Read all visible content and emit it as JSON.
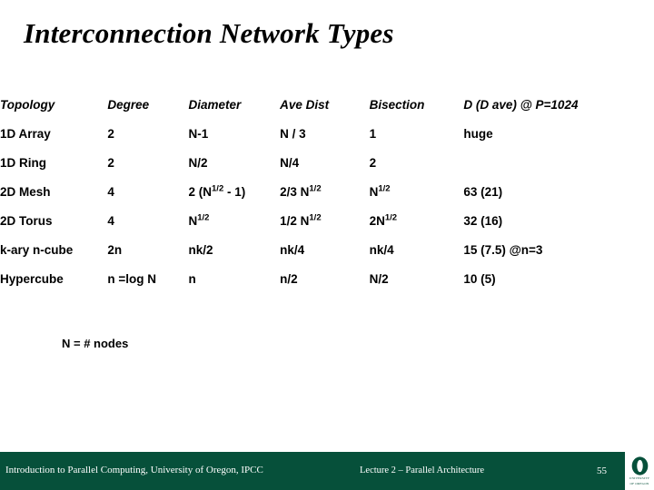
{
  "slide": {
    "title": "Interconnection Network Types",
    "footnote": "N = # nodes"
  },
  "table": {
    "headers": [
      "Topology",
      "Degree",
      "Diameter",
      "Ave Dist",
      "Bisection",
      "D (D ave) @ P=1024"
    ],
    "rows": [
      {
        "topology": "1D Array",
        "degree": "2",
        "diameter": "N-1",
        "ave_dist": "N / 3",
        "bisection": "1",
        "d_ave": "huge"
      },
      {
        "topology": "1D Ring",
        "degree": "2",
        "diameter": "N/2",
        "ave_dist": "N/4",
        "bisection": "2",
        "d_ave": ""
      },
      {
        "topology": "2D Mesh",
        "degree": "4",
        "diameter": "2 (N^1/2 - 1)",
        "ave_dist": "2/3 N^1/2",
        "bisection": "N^1/2",
        "d_ave": "63 (21)"
      },
      {
        "topology": "2D Torus",
        "degree": "4",
        "diameter": "N^1/2",
        "ave_dist": "1/2 N^1/2",
        "bisection": "2N^1/2",
        "d_ave": "32 (16)"
      },
      {
        "topology": "k-ary n-cube",
        "degree": "2n",
        "diameter": "nk/2",
        "ave_dist": "nk/4",
        "bisection": "nk/4",
        "d_ave": "15 (7.5)  @n=3"
      },
      {
        "topology": "Hypercube",
        "degree": "n =log N",
        "diameter": "n",
        "ave_dist": "n/2",
        "bisection": "N/2",
        "d_ave": "10 (5)"
      }
    ]
  },
  "footer": {
    "left": "Introduction to Parallel Computing, University of Oregon, IPCC",
    "center": "Lecture 2 – Parallel Architecture",
    "page_number": "55",
    "logo_line1": "UNIVERSITY",
    "logo_line2": "OF OREGON",
    "bar_color": "#06503a"
  }
}
